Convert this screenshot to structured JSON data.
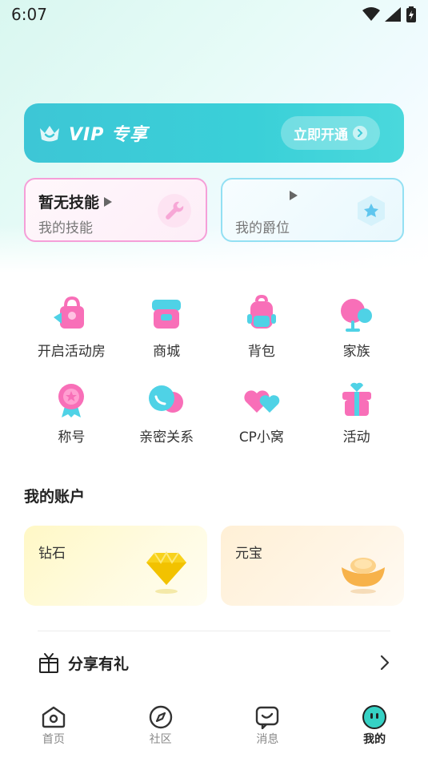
{
  "status_bar": {
    "time": "6:07"
  },
  "vip": {
    "title": "VIP 专享",
    "button_label": "立即开通"
  },
  "skill_card": {
    "title": "暂无技能",
    "subtitle": "我的技能"
  },
  "rank_card": {
    "subtitle": "我的爵位"
  },
  "features": [
    {
      "label": "开启活动房",
      "icon": "gift-bag-icon"
    },
    {
      "label": "商城",
      "icon": "shop-icon"
    },
    {
      "label": "背包",
      "icon": "backpack-icon"
    },
    {
      "label": "家族",
      "icon": "family-icon"
    },
    {
      "label": "称号",
      "icon": "medal-icon"
    },
    {
      "label": "亲密关系",
      "icon": "chat-bubbles-icon"
    },
    {
      "label": "CP小窝",
      "icon": "hearts-icon"
    },
    {
      "label": "活动",
      "icon": "gift-box-icon"
    }
  ],
  "account": {
    "title": "我的账户",
    "diamond_label": "钻石",
    "ingot_label": "元宝"
  },
  "share": {
    "label": "分享有礼"
  },
  "tabs": [
    {
      "label": "首页",
      "icon": "home-icon"
    },
    {
      "label": "社区",
      "icon": "compass-icon"
    },
    {
      "label": "消息",
      "icon": "message-icon"
    },
    {
      "label": "我的",
      "icon": "profile-icon",
      "active": true
    }
  ],
  "colors": {
    "accent": "#3ccbd6",
    "pink": "#f86fb8",
    "cyan": "#4fd2e6"
  }
}
